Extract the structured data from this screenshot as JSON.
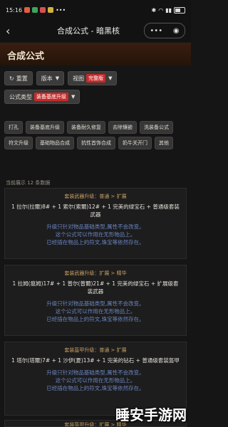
{
  "status": {
    "time": "15:16",
    "signal_text": "•••",
    "battery": "100"
  },
  "nav": {
    "title": "合成公式 - 暗黑核",
    "more_icon": "ellipsis-icon",
    "close_icon": "target-icon"
  },
  "page": {
    "title": "合成公式"
  },
  "controls": {
    "reset_label": "重置",
    "version_label": "版本",
    "view_label": "视图",
    "view_badge": "完整版",
    "formula_type_label": "公式类型",
    "formula_type_badge": "装备基底升级"
  },
  "categories": [
    "打孔",
    "装备基底升级",
    "装备耐久修复",
    "去除镶嵌",
    "洗装备公式",
    "符文升级",
    "基础物品合成",
    "抗性首饰合成",
    "奶牛关开门",
    "其他"
  ],
  "result_count": "当前展示 12 条数据",
  "cards": [
    {
      "title": "套装武器升级：普通 > 扩展",
      "recipe": "1 拉尔(拉爾)8# + 1 索尔(索爾)12# + 1 完美的绿宝石 + 普通级套装武器",
      "notes": [
        "升级只针对物品基础类型,属性不会改变。",
        "这个公式可以作用在无形物品上。",
        "已经插在物品上的符文,珠宝等依然存在。"
      ]
    },
    {
      "title": "套装武器升级：扩展 > 精华",
      "recipe": "1 拉姆(瘟姆)17# + 1 普尔(普爾)21# + 1 完美的绿宝石 + 扩展级套装武器",
      "notes": [
        "升级只针对物品基础类型,属性不会改变。",
        "这个公式可以作用在无形物品上。",
        "已经插在物品上的符文,珠宝等依然存在。"
      ]
    },
    {
      "title": "套装盔甲升级：普通 > 扩展",
      "recipe": "1 塔尔(塔爾)7# + 1 沙伊(夏)13# + 1 完美的钻石 + 普通级套装盔甲",
      "notes": [
        "升级只针对物品基础类型,属性不会改变。",
        "这个公式可以作用在无形物品上。",
        "已经插在物品上的符文,珠宝等依然存在。"
      ]
    },
    {
      "title": "套装盔甲升级：扩展 > 精华",
      "recipe": "",
      "notes": []
    }
  ],
  "watermark": "睡安手游网"
}
